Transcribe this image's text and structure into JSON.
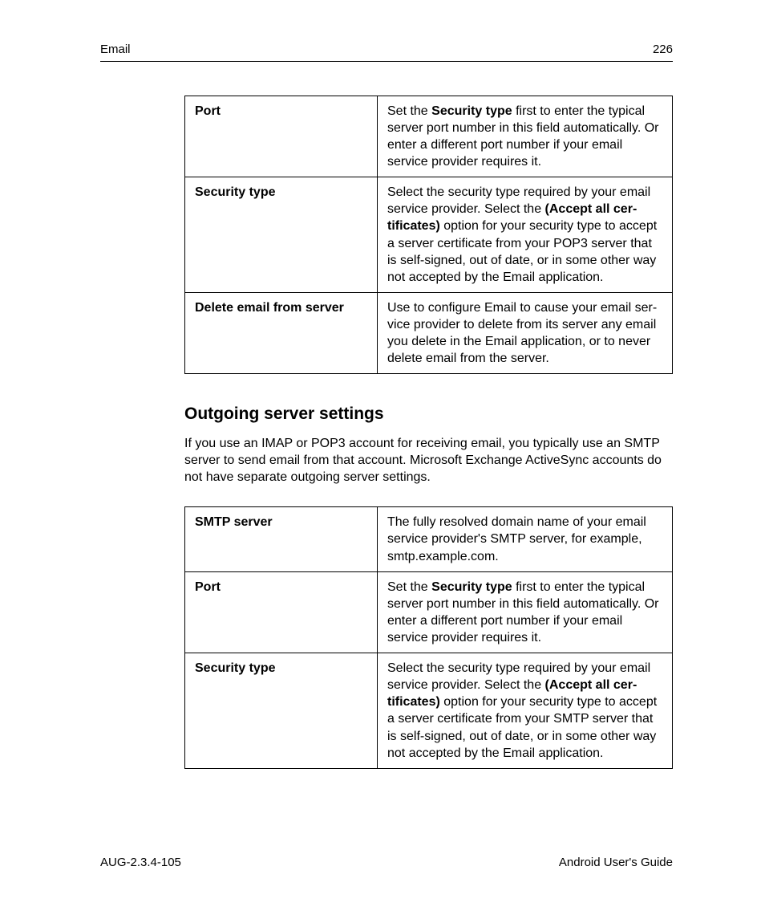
{
  "header": {
    "section": "Email",
    "page_number": "226"
  },
  "incoming_table": {
    "rows": [
      {
        "label": "Port",
        "desc_before_bold": "Set the ",
        "desc_bold": "Security type",
        "desc_after_bold": " first to enter the typical server port number in this field automatically. Or enter a different port number if your email service provider requires it."
      },
      {
        "label": "Security type",
        "desc_before_bold": "Select the security type required by your email service provider. Select the ",
        "desc_bold": "(Accept all cer­tificates)",
        "desc_after_bold": " option for your security type to accept a server certificate from your POP3 server that is self-signed, out of date, or in some other way not accepted by the Email applica­tion."
      },
      {
        "label": "Delete email from server",
        "desc_before_bold": "Use to configure Email to cause your email ser­vice provider to delete from its server any email you delete in the Email application, or to never delete email from the server.",
        "desc_bold": "",
        "desc_after_bold": ""
      }
    ]
  },
  "section": {
    "heading": "Outgoing server settings",
    "intro": "If you use an IMAP or POP3 account for receiving email, you typically use an SMTP server to send email from that account. Microsoft Exchange ActiveSync accounts do not have separate outgoing server settings."
  },
  "outgoing_table": {
    "rows": [
      {
        "label": "SMTP server",
        "desc_before_bold": "The fully resolved domain name of your email service provider's SMTP server, for example, smtp.example.com.",
        "desc_bold": "",
        "desc_after_bold": ""
      },
      {
        "label": "Port",
        "desc_before_bold": "Set the ",
        "desc_bold": "Security type",
        "desc_after_bold": " first to enter the typical server port number in this field automatically. Or enter a different port number if your email service provider requires it."
      },
      {
        "label": "Security type",
        "desc_before_bold": "Select the security type required by your email service provider. Select the ",
        "desc_bold": "(Accept all cer­tificates)",
        "desc_after_bold": " option for your security type to accept a server certificate from your SMTP server that is self-signed, out of date, or in some other way not accepted by the Email applica­tion."
      }
    ]
  },
  "footer": {
    "doc_id": "AUG-2.3.4-105",
    "doc_title": "Android User's Guide"
  }
}
